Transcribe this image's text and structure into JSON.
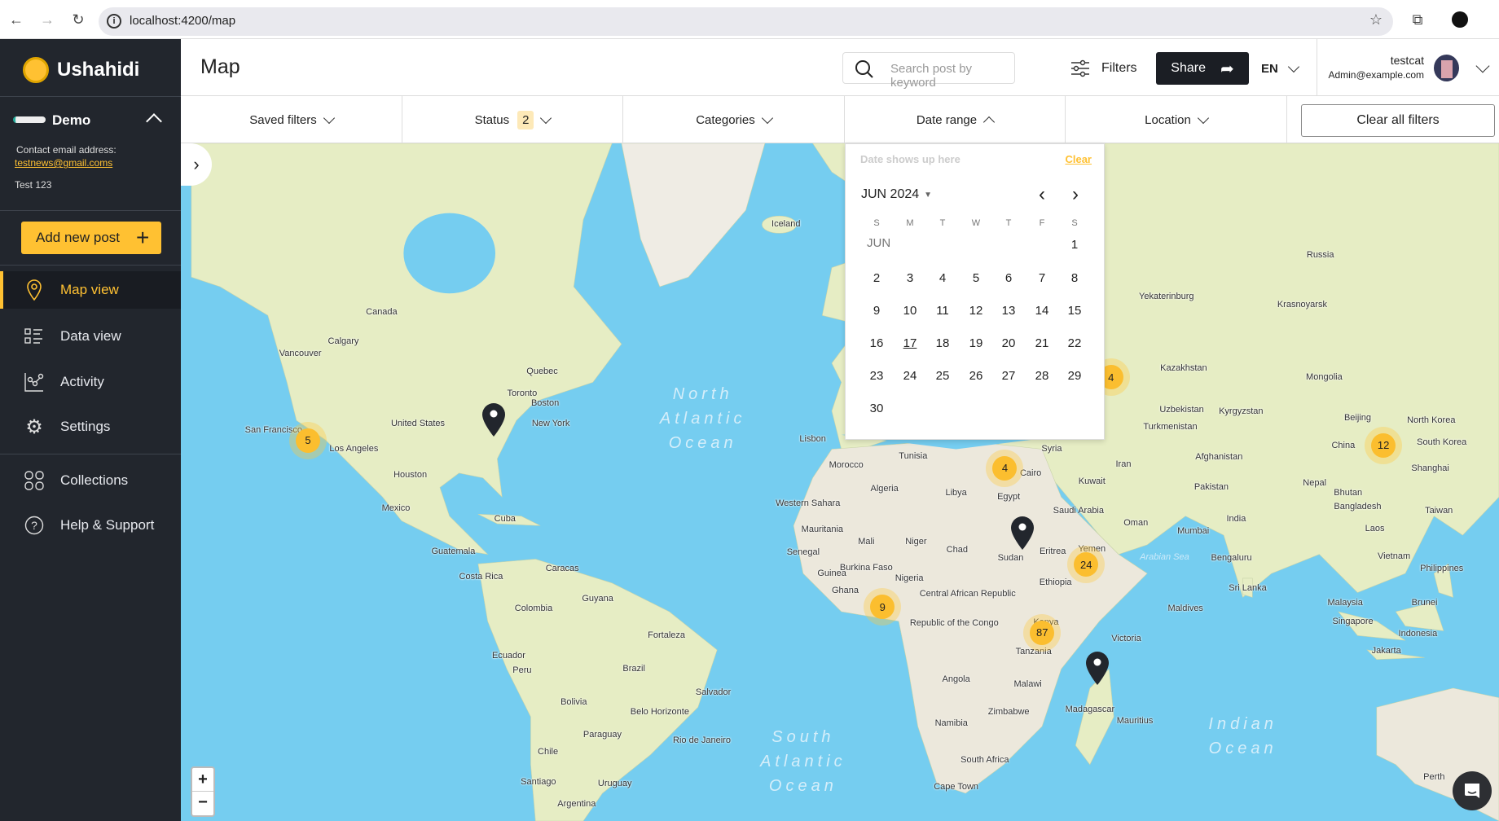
{
  "browser": {
    "url": "localhost:4200/map"
  },
  "sidebar": {
    "brand": "Ushahidi",
    "deployment": "Demo",
    "contact_label": "Contact email address:",
    "contact_email": "testnews@gmail.coms",
    "description": "Test 123",
    "add_post": "Add new post",
    "items": [
      {
        "label": "Map view",
        "icon": "map-pin-icon",
        "active": true
      },
      {
        "label": "Data view",
        "icon": "list-icon"
      },
      {
        "label": "Activity",
        "icon": "chart-icon"
      },
      {
        "label": "Settings",
        "icon": "gear-icon"
      },
      {
        "label": "Collections",
        "icon": "collections-icon"
      },
      {
        "label": "Help & Support",
        "icon": "help-icon"
      }
    ]
  },
  "header": {
    "title": "Map",
    "search_placeholder": "Search post by keyword",
    "filters": "Filters",
    "share": "Share",
    "language": "EN",
    "user_name": "testcat",
    "user_email": "Admin@example.com"
  },
  "filters": {
    "saved": "Saved filters",
    "status": "Status",
    "status_count": "2",
    "categories": "Categories",
    "date_range": "Date range",
    "location": "Location",
    "clear_all": "Clear all filters"
  },
  "calendar": {
    "placeholder": "Date shows up here",
    "clear": "Clear",
    "month": "JUN 2024",
    "month_short": "JUN",
    "weekdays": [
      "S",
      "M",
      "T",
      "W",
      "T",
      "F",
      "S"
    ],
    "today": "17",
    "weeks": [
      [
        "",
        "",
        "",
        "",
        "",
        "",
        "1"
      ],
      [
        "2",
        "3",
        "4",
        "5",
        "6",
        "7",
        "8"
      ],
      [
        "9",
        "10",
        "11",
        "12",
        "13",
        "14",
        "15"
      ],
      [
        "16",
        "17",
        "18",
        "19",
        "20",
        "21",
        "22"
      ],
      [
        "23",
        "24",
        "25",
        "26",
        "27",
        "28",
        "29"
      ],
      [
        "30",
        "",
        "",
        "",
        "",
        "",
        ""
      ]
    ]
  },
  "map": {
    "colors": {
      "water": "#75cdf0",
      "land": "#e6edc4",
      "cluster": "#fbbe2f",
      "pin": "#22262d"
    },
    "clusters": [
      "5",
      "4",
      "12",
      "4",
      "24",
      "9",
      "87"
    ],
    "labels": [
      "Canada",
      "Calgary",
      "Vancouver",
      "United States",
      "San Francisco",
      "Los Angeles",
      "Houston",
      "Mexico",
      "Quebec",
      "Toronto",
      "Boston",
      "New York",
      "Cuba",
      "Guatemala",
      "Costa Rica",
      "Caracas",
      "Guyana",
      "Colombia",
      "Ecuador",
      "Peru",
      "Brazil",
      "Fortaleza",
      "Salvador",
      "Bolivia",
      "Belo Horizonte",
      "Paraguay",
      "Rio de Janeiro",
      "Chile",
      "Santiago",
      "Uruguay",
      "Argentina",
      "Iceland",
      "Russia",
      "Yekaterinburg",
      "Krasnoyarsk",
      "Kazakhstan",
      "Mongolia",
      "Uzbekistan",
      "Kyrgyzstan",
      "Turkmenistan",
      "Beijing",
      "North Korea",
      "South Korea",
      "China",
      "Shanghai",
      "Afghanistan",
      "Iran",
      "Pakistan",
      "Nepal",
      "Bhutan",
      "Bangladesh",
      "Taiwan",
      "India",
      "Mumbai",
      "Laos",
      "Bengaluru",
      "Vietnam",
      "Philippines",
      "Sri Lanka",
      "Maldives",
      "Malaysia",
      "Brunei",
      "Singapore",
      "Indonesia",
      "Jakarta",
      "Lisbon",
      "Morocco",
      "Tunisia",
      "Algeria",
      "Libya",
      "Egypt",
      "Cairo",
      "Syria",
      "Kuwait",
      "Saudi Arabia",
      "Oman",
      "Western Sahara",
      "Mauritania",
      "Mali",
      "Niger",
      "Chad",
      "Sudan",
      "Eritrea",
      "Yemen",
      "Senegal",
      "Guinea",
      "Burkina Faso",
      "Nigeria",
      "Ethiopia",
      "Ghana",
      "Central African Republic",
      "Republic of the Congo",
      "Kenya",
      "Tanzania",
      "Victoria",
      "Angola",
      "Malawi",
      "Zimbabwe",
      "Madagascar",
      "Mauritius",
      "Namibia",
      "South Africa",
      "Cape Town",
      "Perth",
      "Arabian Sea"
    ],
    "oceans": [
      "North\nAtlantic\nOcean",
      "South\nAtlantic\nOcean",
      "Indian\nOcean"
    ],
    "zoom_in": "+",
    "zoom_out": "−"
  }
}
